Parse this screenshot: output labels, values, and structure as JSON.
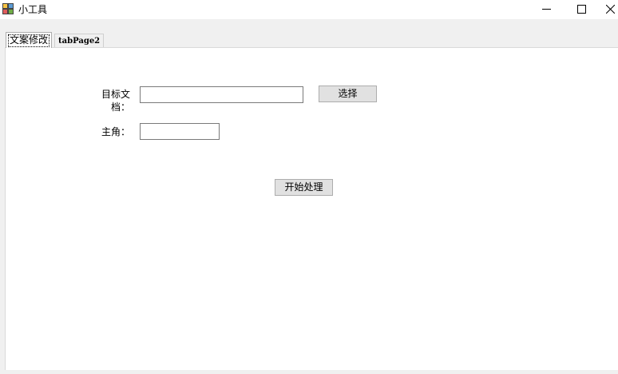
{
  "window": {
    "title": "小工具",
    "icon": "app-form-icon",
    "controls": [
      "minimize-icon",
      "maximize-icon",
      "close-icon"
    ]
  },
  "tabs": [
    {
      "label": "文案修改",
      "active": true
    },
    {
      "label": "tabPage2",
      "active": false
    }
  ],
  "form": {
    "doc_label": "目标文档：",
    "doc_value": "",
    "select_button": "选择",
    "role_label": "主角：",
    "role_value": "",
    "start_button": "开始处理"
  }
}
